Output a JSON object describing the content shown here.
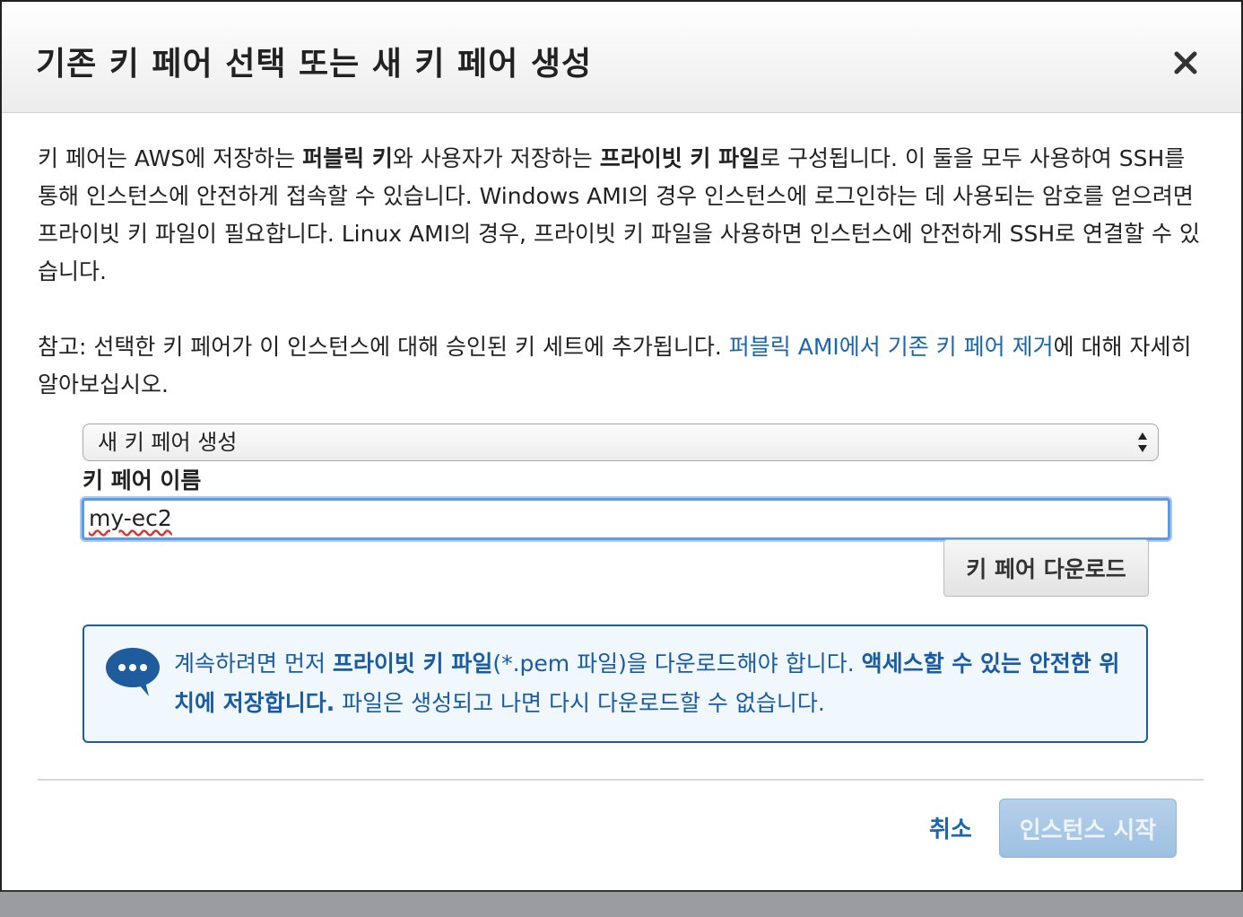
{
  "dialog": {
    "title": "기존 키 페어 선택 또는 새 키 페어 생성",
    "close_icon": "close-icon"
  },
  "intro": {
    "t1": "키 페어는 AWS에 저장하는 ",
    "b1": "퍼블릭 키",
    "t2": "와 사용자가 저장하는 ",
    "b2": "프라이빗 키 파일",
    "t3": "로 구성됩니다. 이 둘을 모두 사용하여 SSH를 통해 인스턴스에 안전하게 접속할 수 있습니다. Windows AMI의 경우 인스턴스에 로그인하는 데 사용되는 암호를 얻으려면 프라이빗 키 파일이 필요합니다. Linux AMI의 경우, 프라이빗 키 파일을 사용하면 인스턴스에 안전하게 SSH로 연결할 수 있습니다."
  },
  "note": {
    "t1": "참고: 선택한 키 페어가 이 인스턴스에 대해 승인된 키 세트에 추가됩니다. ",
    "link": "퍼블릭 AMI에서 기존 키 페어 제거",
    "t2": "에 대해 자세히 알아보십시오."
  },
  "keypair_select": {
    "selected": "새 키 페어 생성"
  },
  "keypair_name": {
    "label": "키 페어 이름",
    "value": "my-ec2"
  },
  "download_button": "키 페어 다운로드",
  "alert": {
    "icon": "chat-bubble-icon",
    "t1": "계속하려면 먼저 ",
    "b1": "프라이빗 키 파일",
    "t2": "(*.pem 파일)을 다운로드해야 합니다. ",
    "b2": "액세스할 수 있는 안전한 위치에 저장합니다.",
    "t3": " 파일은 생성되고 나면 다시 다운로드할 수 없습니다."
  },
  "footer": {
    "cancel": "취소",
    "launch": "인스턴스 시작"
  },
  "colors": {
    "link": "#1a66b0",
    "alert_border": "#1f5c9e",
    "alert_bg": "#f1f8fd",
    "input_focus": "#5b9bea",
    "launch_disabled": "#a9c8e6"
  }
}
